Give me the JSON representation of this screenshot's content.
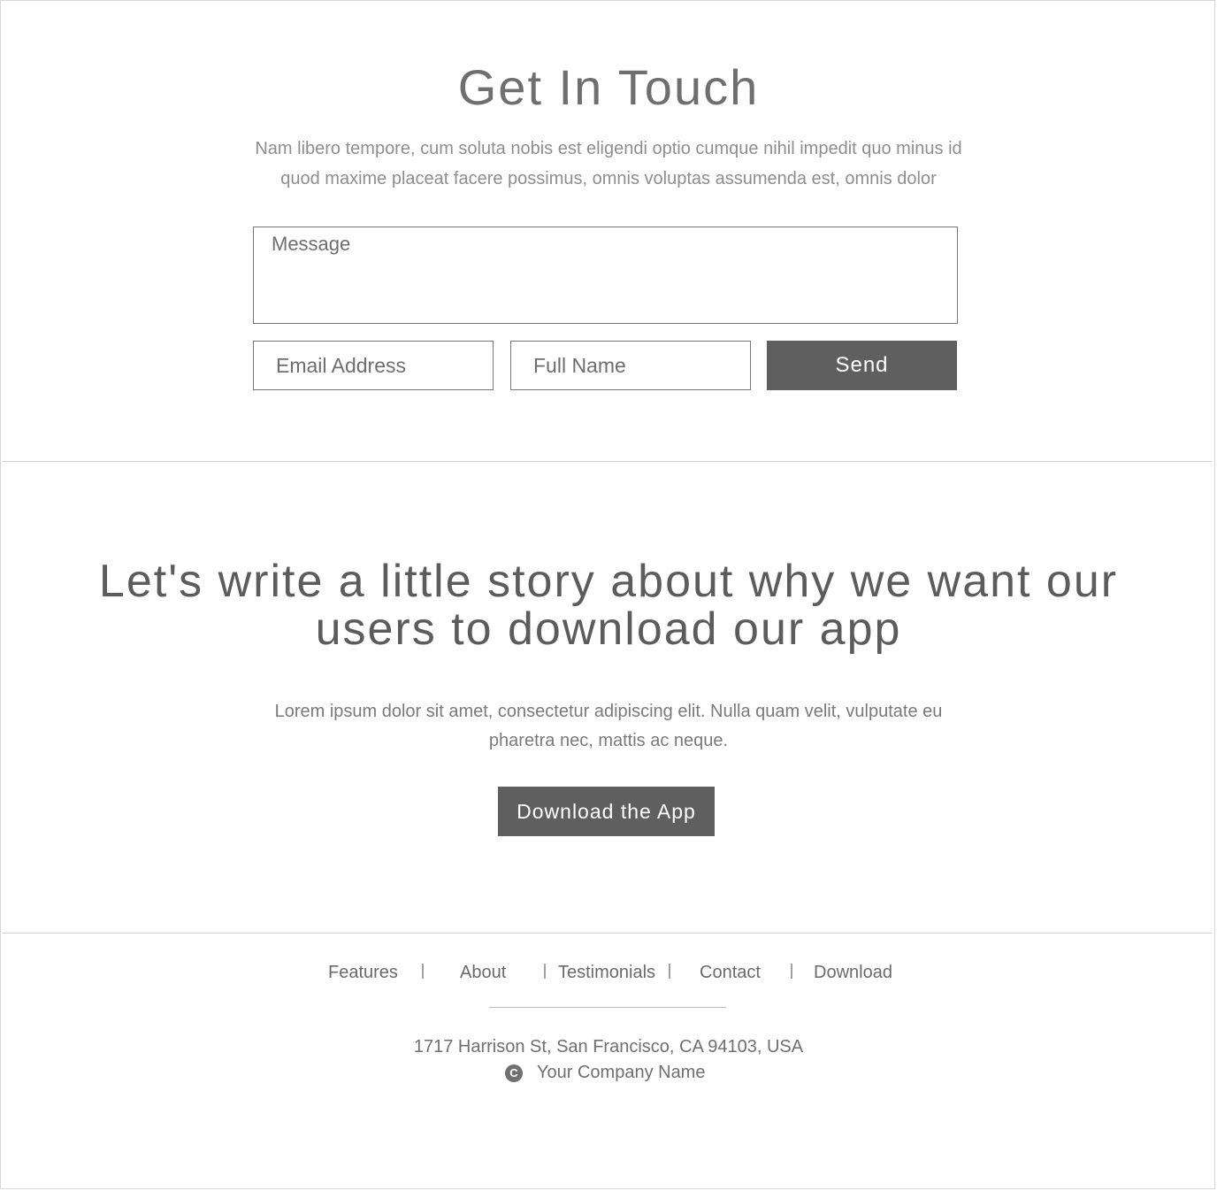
{
  "contact": {
    "title": "Get In Touch",
    "intro_line1": "Nam libero tempore, cum soluta nobis est eligendi optio cumque nihil impedit quo minus id",
    "intro_line2": "quod maxime placeat facere possimus, omnis voluptas assumenda est, omnis dolor",
    "message_placeholder": "Message",
    "email_placeholder": "Email Address",
    "name_placeholder": "Full Name",
    "send_label": "Send"
  },
  "story": {
    "title_line1": "Let's write a little story about why we want our",
    "title_line2": "users to download our app",
    "sub_line1": "Lorem ipsum dolor sit amet, consectetur adipiscing elit. Nulla quam velit, vulputate eu",
    "sub_line2": "pharetra nec, mattis ac neque.",
    "button_label": "Download the App"
  },
  "footer": {
    "nav": [
      "Features",
      "About",
      "Testimonials",
      "Contact",
      "Download"
    ],
    "address": "1717 Harrison St, San Francisco, CA 94103, USA",
    "copyright_icon": "copyright-icon",
    "copyright_glyph": "C",
    "company": "Your Company Name"
  },
  "colors": {
    "button_bg": "#5f5f5f",
    "text": "#6b6b6b",
    "divider": "#cfcfcf"
  }
}
